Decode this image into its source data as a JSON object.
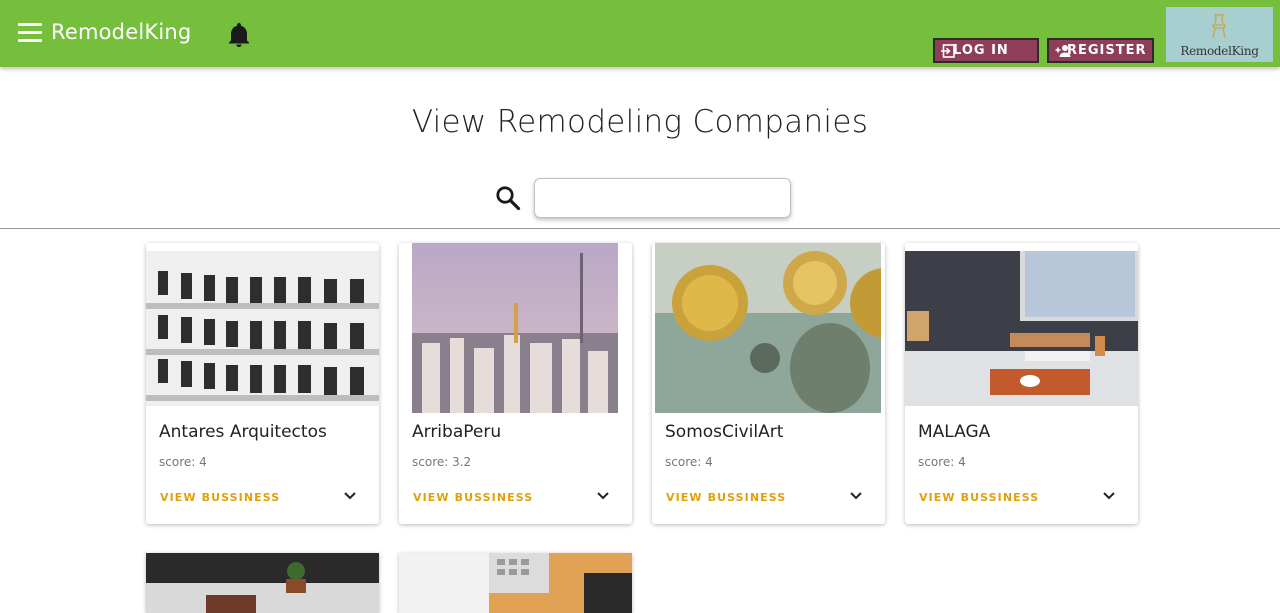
{
  "header": {
    "brand": "RemodelKing",
    "login_label": "LOG IN",
    "register_label": "REGISTER",
    "logo_text": "RemodelKing",
    "color": "#76bf3c",
    "button_color": "#8e3e56"
  },
  "main": {
    "title": "View Remodeling Companies",
    "search": {
      "value": "",
      "placeholder": ""
    }
  },
  "companies": [
    {
      "name": "Antares Arquitectos",
      "score": "score: 4",
      "link": "VIEW BUSSINESS"
    },
    {
      "name": "ArribaPeru",
      "score": "score: 3.2",
      "link": "VIEW BUSSINESS"
    },
    {
      "name": "SomosCivilArt",
      "score": "score: 4",
      "link": "VIEW BUSSINESS"
    },
    {
      "name": "MALAGA",
      "score": "score: 4",
      "link": "VIEW BUSSINESS"
    }
  ],
  "icons": [
    "menu-icon",
    "bell-icon",
    "login-icon",
    "register-icon",
    "search-icon",
    "chevron-down-icon"
  ]
}
